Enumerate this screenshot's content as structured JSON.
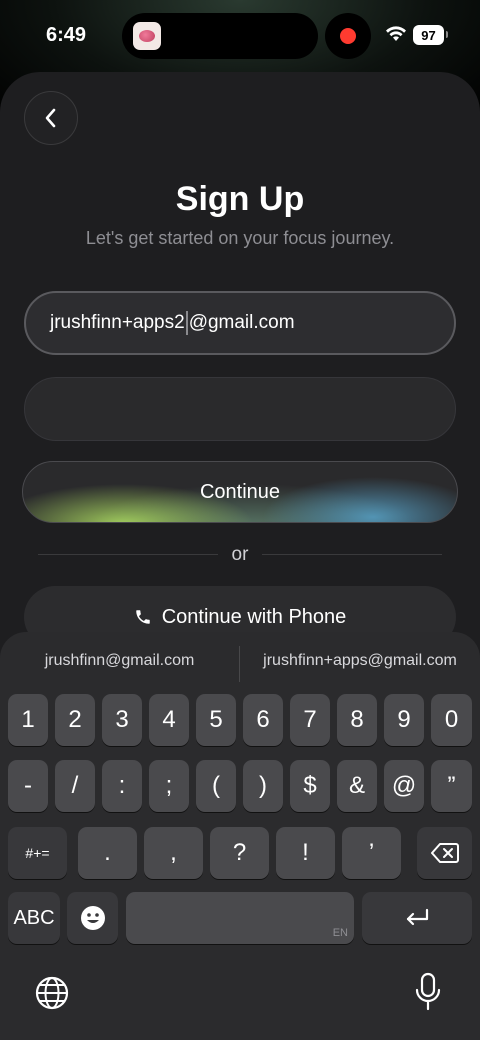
{
  "status_bar": {
    "time": "6:49",
    "battery": "97"
  },
  "page": {
    "title": "Sign Up",
    "subtitle": "Let's get started on your focus journey.",
    "email_before_caret": "jrushfinn+apps2",
    "email_after_caret": "@gmail.com",
    "password_value": "",
    "continue_label": "Continue",
    "or_label": "or",
    "phone_label": "Continue with Phone"
  },
  "keyboard": {
    "suggestions": [
      "jrushfinn@gmail.com",
      "jrushfinn+apps@gmail.com"
    ],
    "row1": [
      "1",
      "2",
      "3",
      "4",
      "5",
      "6",
      "7",
      "8",
      "9",
      "0"
    ],
    "row2": [
      "-",
      "/",
      ":",
      ";",
      "(",
      ")",
      "$",
      "&",
      "@",
      "”"
    ],
    "row3": [
      ".",
      ",",
      "?",
      "!",
      "’"
    ],
    "symbols_key": "#+=",
    "abc_key": "ABC",
    "space_lang": "EN"
  },
  "icons": {
    "back": "chevron-left-icon",
    "phone": "phone-icon",
    "delete": "delete-left-icon",
    "return": "return-icon",
    "emoji": "emoji-icon",
    "globe": "globe-icon",
    "mic": "microphone-icon",
    "wifi": "wifi-icon"
  },
  "colors": {
    "background": "#1e1e20",
    "keyboard": "#2b2b2d",
    "key": "#4a4a4d",
    "record": "#ff3b30"
  }
}
